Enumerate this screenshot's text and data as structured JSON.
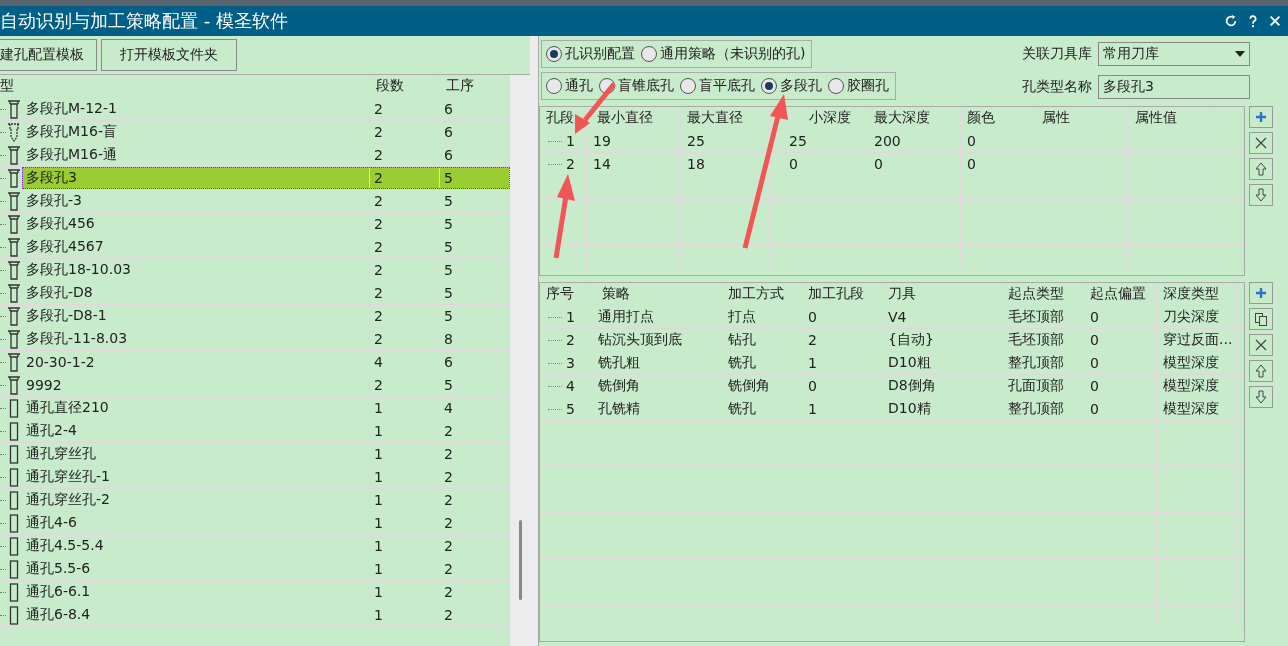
{
  "window": {
    "title": "自动识别与加工策略配置 - 模圣软件"
  },
  "toolbar": {
    "buttons": [
      "建孔配置模板",
      "打开模板文件夹"
    ]
  },
  "hole_list": {
    "columns": [
      "型",
      "段数",
      "工序"
    ],
    "rows": [
      {
        "kind": "multi",
        "name": "多段孔M-12-1",
        "segments": "2",
        "steps": "6",
        "selected": false
      },
      {
        "kind": "blind",
        "name": "多段孔M16-盲",
        "segments": "2",
        "steps": "6",
        "selected": false
      },
      {
        "kind": "multi",
        "name": "多段孔M16-通",
        "segments": "2",
        "steps": "6",
        "selected": false
      },
      {
        "kind": "multi",
        "name": "多段孔3",
        "segments": "2",
        "steps": "5",
        "selected": true
      },
      {
        "kind": "multi",
        "name": "多段孔-3",
        "segments": "2",
        "steps": "5",
        "selected": false
      },
      {
        "kind": "multi",
        "name": "多段孔456",
        "segments": "2",
        "steps": "5",
        "selected": false
      },
      {
        "kind": "multi",
        "name": "多段孔4567",
        "segments": "2",
        "steps": "5",
        "selected": false
      },
      {
        "kind": "multi",
        "name": "多段孔18-10.03",
        "segments": "2",
        "steps": "5",
        "selected": false
      },
      {
        "kind": "multi",
        "name": "多段孔-D8",
        "segments": "2",
        "steps": "5",
        "selected": false
      },
      {
        "kind": "multi",
        "name": "多段孔-D8-1",
        "segments": "2",
        "steps": "5",
        "selected": false
      },
      {
        "kind": "multi",
        "name": "多段孔-11-8.03",
        "segments": "2",
        "steps": "8",
        "selected": false
      },
      {
        "kind": "multi",
        "name": "20-30-1-2",
        "segments": "4",
        "steps": "6",
        "selected": false
      },
      {
        "kind": "multi",
        "name": "9992",
        "segments": "2",
        "steps": "5",
        "selected": false
      },
      {
        "kind": "through",
        "name": "通孔直径210",
        "segments": "1",
        "steps": "4",
        "selected": false
      },
      {
        "kind": "through",
        "name": "通孔2-4",
        "segments": "1",
        "steps": "2",
        "selected": false
      },
      {
        "kind": "through",
        "name": "通孔穿丝孔",
        "segments": "1",
        "steps": "2",
        "selected": false
      },
      {
        "kind": "through",
        "name": "通孔穿丝孔-1",
        "segments": "1",
        "steps": "2",
        "selected": false
      },
      {
        "kind": "through",
        "name": "通孔穿丝孔-2",
        "segments": "1",
        "steps": "2",
        "selected": false
      },
      {
        "kind": "through",
        "name": "通孔4-6",
        "segments": "1",
        "steps": "2",
        "selected": false
      },
      {
        "kind": "through",
        "name": "通孔4.5-5.4",
        "segments": "1",
        "steps": "2",
        "selected": false
      },
      {
        "kind": "through",
        "name": "通孔5.5-6",
        "segments": "1",
        "steps": "2",
        "selected": false
      },
      {
        "kind": "through",
        "name": "通孔6-6.1",
        "segments": "1",
        "steps": "2",
        "selected": false
      },
      {
        "kind": "through",
        "name": "通孔6-8.4",
        "segments": "1",
        "steps": "2",
        "selected": false
      }
    ]
  },
  "mode_options": [
    {
      "label": "孔识别配置",
      "selected": true
    },
    {
      "label": "通用策略（未识别的孔)",
      "selected": false
    }
  ],
  "hole_types": [
    {
      "label": "通孔",
      "selected": false
    },
    {
      "label": "盲锥底孔",
      "selected": false
    },
    {
      "label": "盲平底孔",
      "selected": false
    },
    {
      "label": "多段孔",
      "selected": true
    },
    {
      "label": "胶圈孔",
      "selected": false
    }
  ],
  "tool_library": {
    "label": "关联刀具库",
    "value": "常用刀库"
  },
  "hole_type_name": {
    "label": "孔类型名称",
    "value": "多段孔3"
  },
  "segments_table": {
    "columns": [
      "孔段",
      "最小直径",
      "最大直径",
      "小深度",
      "最大深度",
      "颜色",
      "属性",
      "属性值"
    ],
    "rows": [
      [
        "1",
        "19",
        "25",
        "25",
        "200",
        "0",
        "",
        ""
      ],
      [
        "2",
        "14",
        "18",
        "0",
        "0",
        "0",
        "",
        ""
      ]
    ]
  },
  "strategy_table": {
    "columns": [
      "序号",
      "策略",
      "加工方式",
      "加工孔段",
      "刀具",
      "起点类型",
      "起点偏置",
      "深度类型"
    ],
    "rows": [
      [
        "1",
        "通用打点",
        "打点",
        "0",
        "V4",
        "毛坯顶部",
        "0",
        "刀尖深度"
      ],
      [
        "2",
        "钻沉头顶到底",
        "钻孔",
        "2",
        "{自动}",
        "毛坯顶部",
        "0",
        "穿过反面..."
      ],
      [
        "3",
        "铣孔粗",
        "铣孔",
        "1",
        "D10粗",
        "整孔顶部",
        "0",
        "模型深度"
      ],
      [
        "4",
        "铣倒角",
        "铣倒角",
        "0",
        "D8倒角",
        "孔面顶部",
        "0",
        "模型深度"
      ],
      [
        "5",
        "孔铣精",
        "铣孔",
        "1",
        "D10精",
        "整孔顶部",
        "0",
        "模型深度"
      ]
    ]
  }
}
